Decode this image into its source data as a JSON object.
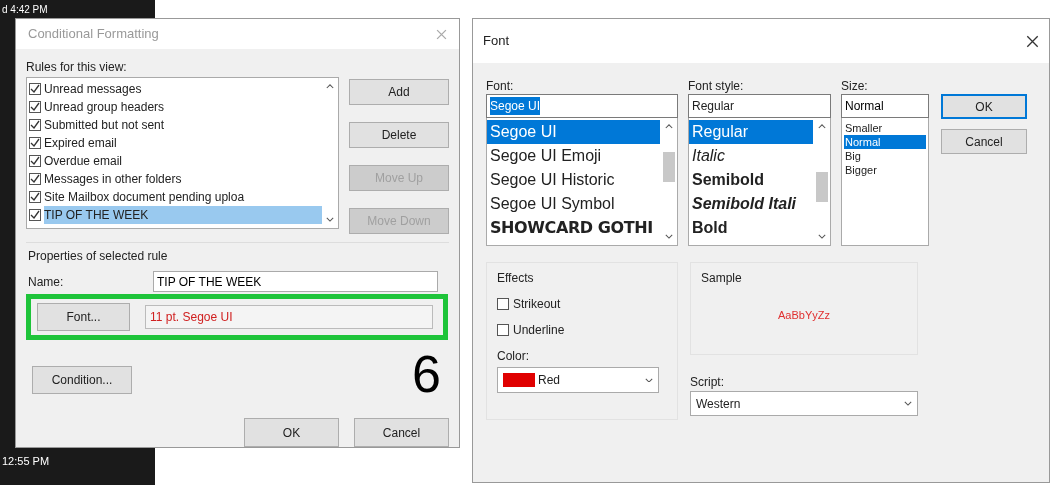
{
  "background": {
    "timestamps": [
      "d 4:42 PM",
      "12:55 PM"
    ]
  },
  "conditional_dialog": {
    "title": "Conditional Formatting",
    "rules_label": "Rules for this view:",
    "rules": [
      {
        "label": "Unread messages",
        "checked": true,
        "selected": false
      },
      {
        "label": "Unread group headers",
        "checked": true,
        "selected": false
      },
      {
        "label": "Submitted but not sent",
        "checked": true,
        "selected": false
      },
      {
        "label": "Expired email",
        "checked": true,
        "selected": false
      },
      {
        "label": "Overdue email",
        "checked": true,
        "selected": false
      },
      {
        "label": "Messages in other folders",
        "checked": true,
        "selected": false
      },
      {
        "label": "Site Mailbox document pending uploa",
        "checked": true,
        "selected": false
      },
      {
        "label": "TIP OF THE WEEK",
        "checked": true,
        "selected": true
      }
    ],
    "buttons": [
      {
        "label": "Add",
        "disabled": false
      },
      {
        "label": "Delete",
        "disabled": false
      },
      {
        "label": "Move Up",
        "disabled": true
      },
      {
        "label": "Move Down",
        "disabled": true
      }
    ],
    "properties_label": "Properties of selected rule",
    "name_label": "Name:",
    "name_value": "TIP OF THE WEEK",
    "font_button": "Font...",
    "font_value": "11 pt. Segoe UI",
    "condition_button": "Condition...",
    "step_number": "6",
    "ok": "OK",
    "cancel": "Cancel"
  },
  "font_dialog": {
    "title": "Font",
    "font_label": "Font:",
    "font_value": "Segoe UI",
    "style_label": "Font style:",
    "style_value": "Regular",
    "size_label": "Size:",
    "size_value": "Normal",
    "fonts": [
      {
        "label": "Segoe UI",
        "kind": "normal",
        "selected": true
      },
      {
        "label": "Segoe UI Emoji",
        "kind": "normal",
        "selected": false
      },
      {
        "label": "Segoe UI Historic",
        "kind": "normal",
        "selected": false
      },
      {
        "label": "Segoe UI Symbol",
        "kind": "normal",
        "selected": false
      },
      {
        "label": "SHOWCARD GOTHI",
        "kind": "display",
        "selected": false
      }
    ],
    "styles": [
      {
        "label": "Regular",
        "kind": "normal",
        "selected": true
      },
      {
        "label": "Italic",
        "kind": "italic",
        "selected": false
      },
      {
        "label": "Semibold",
        "kind": "bold",
        "selected": false
      },
      {
        "label": "Semibold Itali",
        "kind": "bold_italic",
        "selected": false
      },
      {
        "label": "Bold",
        "kind": "bold",
        "selected": false
      }
    ],
    "sizes": [
      {
        "label": "Smaller",
        "selected": false
      },
      {
        "label": "Normal",
        "selected": true
      },
      {
        "label": "Big",
        "selected": false
      },
      {
        "label": "Bigger",
        "selected": false
      }
    ],
    "ok": "OK",
    "cancel": "Cancel",
    "effects_label": "Effects",
    "effects": [
      {
        "label": "Strikeout",
        "checked": false
      },
      {
        "label": "Underline",
        "checked": false
      }
    ],
    "color_label": "Color:",
    "color_value": "Red",
    "sample_label": "Sample",
    "sample_text": "AaBbYyZz",
    "script_label": "Script:",
    "script_value": "Western"
  }
}
